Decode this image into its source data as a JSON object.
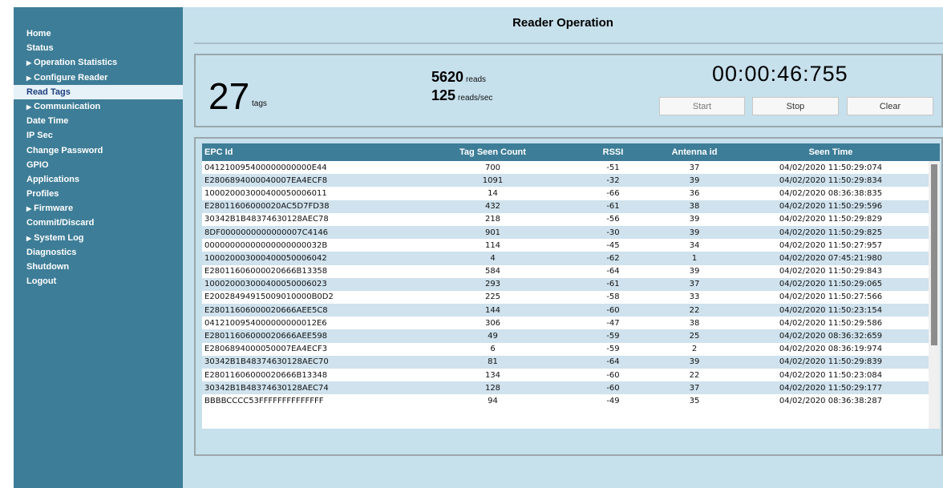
{
  "sidebar": {
    "items": [
      {
        "label": "Home",
        "arrow": false,
        "active": false
      },
      {
        "label": "Status",
        "arrow": false,
        "active": false
      },
      {
        "label": "Operation Statistics",
        "arrow": true,
        "active": false
      },
      {
        "label": "Configure Reader",
        "arrow": true,
        "active": false
      },
      {
        "label": "Read Tags",
        "arrow": false,
        "active": true
      },
      {
        "label": "Communication",
        "arrow": true,
        "active": false
      },
      {
        "label": "Date Time",
        "arrow": false,
        "active": false
      },
      {
        "label": "IP Sec",
        "arrow": false,
        "active": false
      },
      {
        "label": "Change Password",
        "arrow": false,
        "active": false
      },
      {
        "label": "GPIO",
        "arrow": false,
        "active": false
      },
      {
        "label": "Applications",
        "arrow": false,
        "active": false
      },
      {
        "label": "Profiles",
        "arrow": false,
        "active": false
      },
      {
        "label": "Firmware",
        "arrow": true,
        "active": false
      },
      {
        "label": "Commit/Discard",
        "arrow": false,
        "active": false
      },
      {
        "label": "System Log",
        "arrow": true,
        "active": false
      },
      {
        "label": "Diagnostics",
        "arrow": false,
        "active": false
      },
      {
        "label": "Shutdown",
        "arrow": false,
        "active": false
      },
      {
        "label": "Logout",
        "arrow": false,
        "active": false
      }
    ]
  },
  "header": {
    "title": "Reader Operation"
  },
  "stats": {
    "tag_count": "27",
    "tag_unit": "tags",
    "reads": "5620",
    "reads_unit": "reads",
    "rate": "125",
    "rate_unit": "reads/sec",
    "timer": "00:00:46:755"
  },
  "controls": {
    "start_label": "Start",
    "stop_label": "Stop",
    "clear_label": "Clear"
  },
  "table": {
    "columns": [
      "EPC Id",
      "Tag Seen Count",
      "RSSI",
      "Antenna id",
      "Seen Time"
    ],
    "rows": [
      [
        "041210095400000000000E44",
        "700",
        "-51",
        "37",
        "04/02/2020 11:50:29:074"
      ],
      [
        "E2806894000040007EA4ECF8",
        "1091",
        "-32",
        "39",
        "04/02/2020 11:50:29:834"
      ],
      [
        "100020003000400050006011",
        "14",
        "-66",
        "36",
        "04/02/2020 08:36:38:835"
      ],
      [
        "E28011606000020AC5D7FD38",
        "432",
        "-61",
        "38",
        "04/02/2020 11:50:29:596"
      ],
      [
        "30342B1B48374630128AEC78",
        "218",
        "-56",
        "39",
        "04/02/2020 11:50:29:829"
      ],
      [
        "8DF0000000000000007C4146",
        "901",
        "-30",
        "39",
        "04/02/2020 11:50:29:825"
      ],
      [
        "00000000000000000000032B",
        "114",
        "-45",
        "34",
        "04/02/2020 11:50:27:957"
      ],
      [
        "100020003000400050006042",
        "4",
        "-62",
        "1",
        "04/02/2020 07:45:21:980"
      ],
      [
        "E28011606000020666B13358",
        "584",
        "-64",
        "39",
        "04/02/2020 11:50:29:843"
      ],
      [
        "100020003000400050006023",
        "293",
        "-61",
        "37",
        "04/02/2020 11:50:29:065"
      ],
      [
        "E20028494915009010000B0D2",
        "225",
        "-58",
        "33",
        "04/02/2020 11:50:27:566"
      ],
      [
        "E28011606000020666AEE5C8",
        "144",
        "-60",
        "22",
        "04/02/2020 11:50:23:154"
      ],
      [
        "0412100954000000000012E6",
        "306",
        "-47",
        "38",
        "04/02/2020 11:50:29:586"
      ],
      [
        "E28011606000020666AEE598",
        "49",
        "-59",
        "25",
        "04/02/2020 08:36:32:659"
      ],
      [
        "E2806894000050007EA4ECF3",
        "6",
        "-59",
        "2",
        "04/02/2020 08:36:19:974"
      ],
      [
        "30342B1B48374630128AEC70",
        "81",
        "-64",
        "39",
        "04/02/2020 11:50:29:839"
      ],
      [
        "E28011606000020666B13348",
        "134",
        "-60",
        "22",
        "04/02/2020 11:50:23:084"
      ],
      [
        "30342B1B48374630128AEC74",
        "128",
        "-60",
        "37",
        "04/02/2020 11:50:29:177"
      ],
      [
        "BBBBCCCC53FFFFFFFFFFFFFF",
        "94",
        "-49",
        "35",
        "04/02/2020 08:36:38:287"
      ]
    ]
  },
  "colors": {
    "sidebar_bg": "#3d7d97",
    "main_bg": "#c6e0ec",
    "row_alt": "#cfe2ed",
    "active_text": "#1e3e7e"
  }
}
